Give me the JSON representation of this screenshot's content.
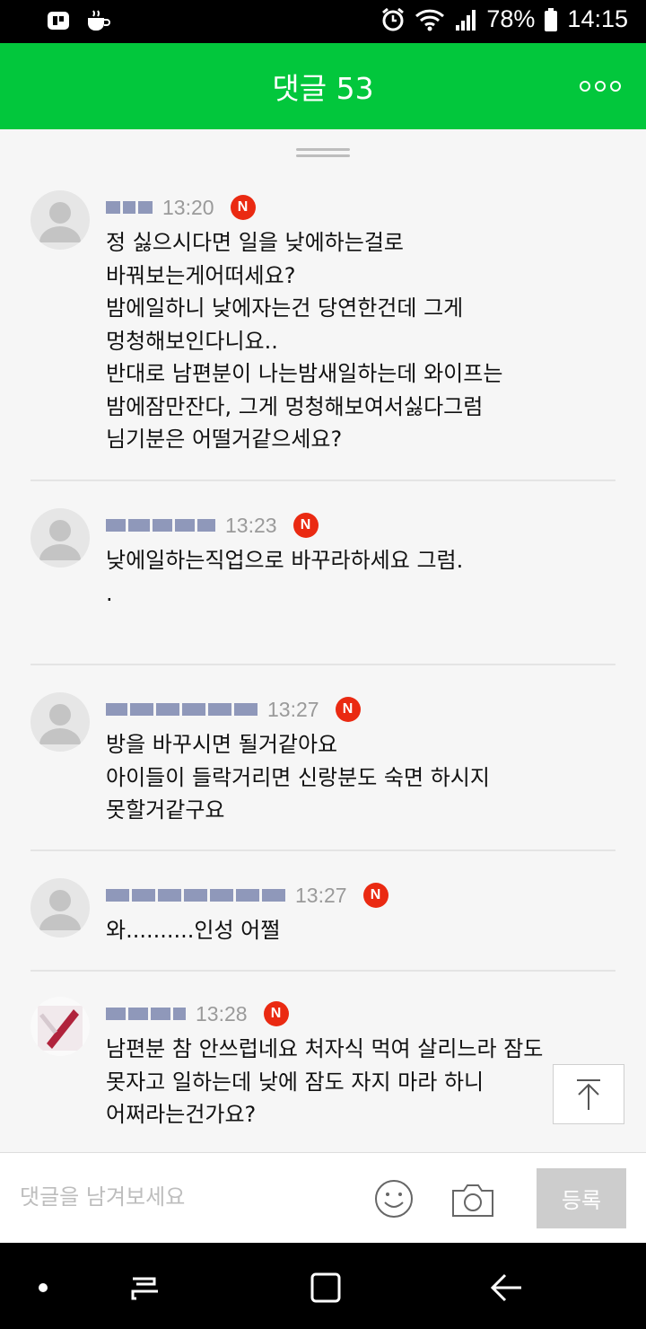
{
  "status_bar": {
    "battery": "78%",
    "time": "14:15"
  },
  "header": {
    "title": "댓글 53"
  },
  "comments": [
    {
      "time": "13:20",
      "badge": "N",
      "text": "정 싫으시다면 일을 낮에하는걸로\n바꿔보는게어떠세요?\n밤에일하니 낮에자는건 당연한건데 그게\n멍청해보인다니요..\n반대로 남편분이 나는밤새일하는데 와이프는\n밤에잠만잔다, 그게 멍청해보여서싫다그럼\n님기분은 어떨거같으세요?"
    },
    {
      "time": "13:23",
      "badge": "N",
      "text": "낮에일하는직업으로 바꾸라하세요 그럼.\n."
    },
    {
      "time": "13:27",
      "badge": "N",
      "text": "방을 바꾸시면 될거같아요\n아이들이 들락거리면 신랑분도 숙면 하시지\n못할거같구요"
    },
    {
      "time": "13:27",
      "badge": "N",
      "text": "와..........인성 어쩔"
    },
    {
      "time": "13:28",
      "badge": "N",
      "text": "남편분 참 안쓰럽네요 처자식 먹여 살리느라 잠도\n못자고 일하는데 낮에 잠도 자지 마라 하니\n어쩌라는건가요?"
    }
  ],
  "input": {
    "placeholder": "댓글을 남겨보세요",
    "submit_label": "등록"
  },
  "colors": {
    "header_green": "#02c73c",
    "badge_red": "#ea2a12"
  }
}
